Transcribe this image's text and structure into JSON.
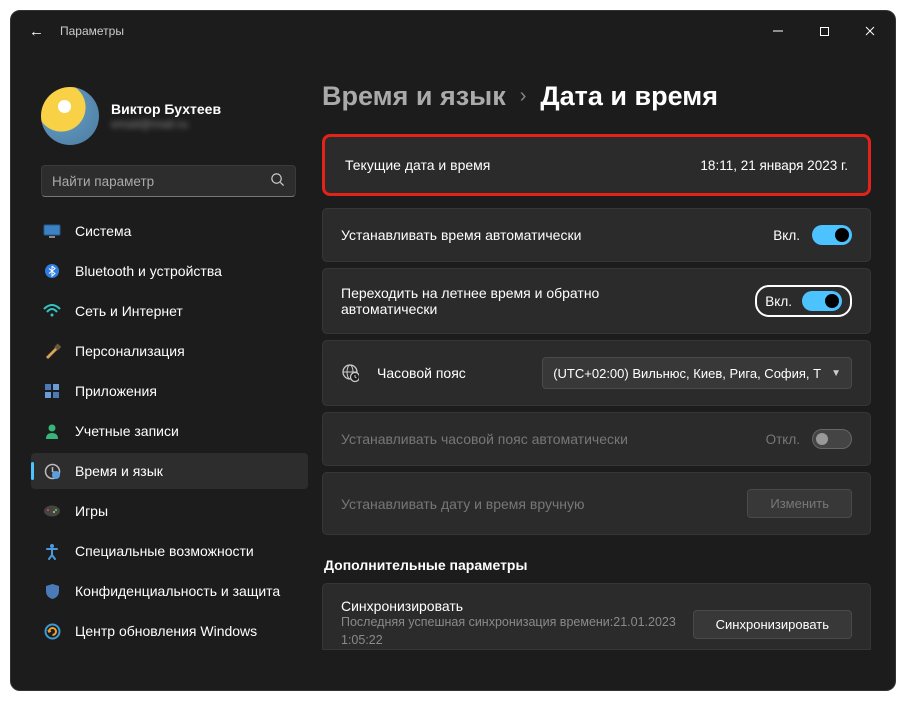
{
  "window": {
    "title": "Параметры"
  },
  "profile": {
    "name": "Виктор Бухтеев",
    "email": "email@mail.ru"
  },
  "search": {
    "placeholder": "Найти параметр"
  },
  "sidebar": {
    "items": [
      {
        "label": "Система",
        "icon": "system"
      },
      {
        "label": "Bluetooth и устройства",
        "icon": "bluetooth"
      },
      {
        "label": "Сеть и Интернет",
        "icon": "wifi"
      },
      {
        "label": "Персонализация",
        "icon": "brush"
      },
      {
        "label": "Приложения",
        "icon": "apps"
      },
      {
        "label": "Учетные записи",
        "icon": "account"
      },
      {
        "label": "Время и язык",
        "icon": "time",
        "active": true
      },
      {
        "label": "Игры",
        "icon": "games"
      },
      {
        "label": "Специальные возможности",
        "icon": "access"
      },
      {
        "label": "Конфиденциальность и защита",
        "icon": "privacy"
      },
      {
        "label": "Центр обновления Windows",
        "icon": "update"
      }
    ]
  },
  "breadcrumb": {
    "level1": "Время и язык",
    "level2": "Дата и время"
  },
  "current": {
    "label": "Текущие дата и время",
    "value": "18:11, 21 января 2023 г."
  },
  "autoTime": {
    "label": "Устанавливать время автоматически",
    "state": "Вкл."
  },
  "dst": {
    "label": "Переходить на летнее время и обратно автоматически",
    "state": "Вкл."
  },
  "timezone": {
    "label": "Часовой пояс",
    "value": "(UTC+02:00) Вильнюс, Киев, Рига, София, Т"
  },
  "autoTz": {
    "label": "Устанавливать часовой пояс автоматически",
    "state": "Откл."
  },
  "manual": {
    "label": "Устанавливать дату и время вручную",
    "button": "Изменить"
  },
  "additional": {
    "title": "Дополнительные параметры"
  },
  "sync": {
    "label": "Синхронизировать",
    "sub1": "Последняя успешная синхронизация времени:21.01.2023 1:05:22",
    "button": "Синхронизировать"
  }
}
